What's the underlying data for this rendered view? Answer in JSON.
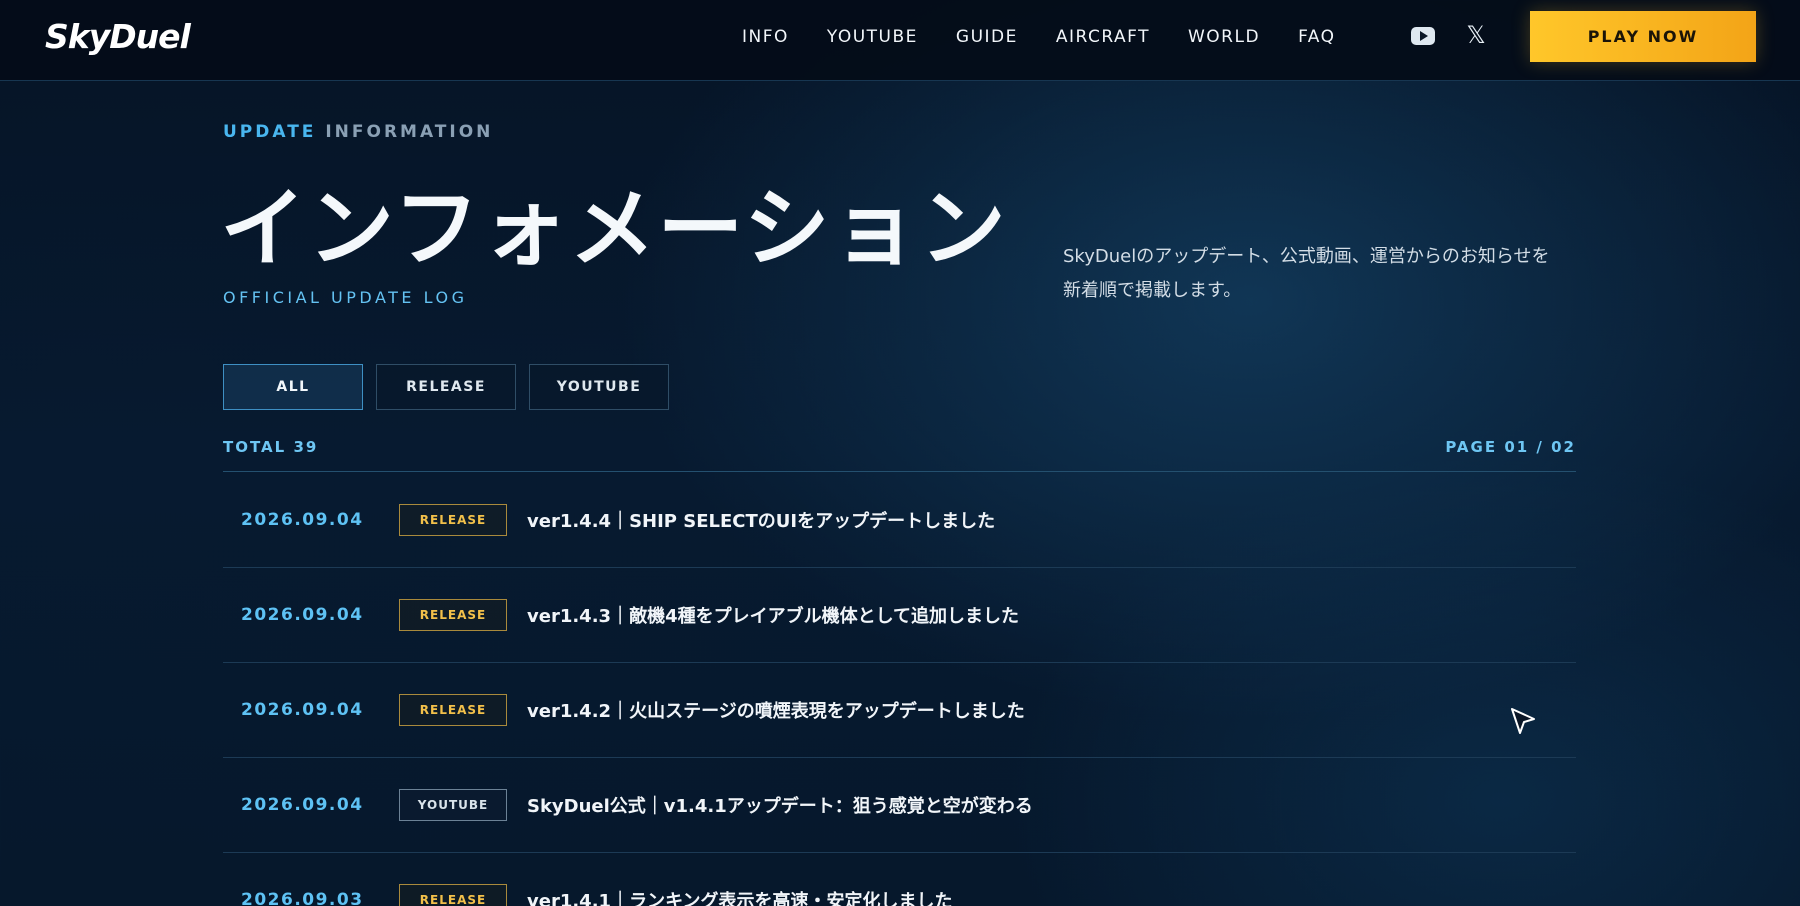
{
  "header": {
    "logo": "SkyDuel",
    "nav": [
      "INFO",
      "YOUTUBE",
      "GUIDE",
      "AIRCRAFT",
      "WORLD",
      "FAQ"
    ],
    "x_icon": "𝕏",
    "play_button": "PLAY NOW"
  },
  "hero": {
    "eyebrow_accent": "UPDATE",
    "eyebrow_rest": "INFORMATION",
    "title": "インフォメーション",
    "subtitle": "OFFICIAL UPDATE LOG",
    "description_line1": "SkyDuelのアップデート、公式動画、運営からのお知らせを",
    "description_line2": "新着順で掲載します。"
  },
  "filters": [
    {
      "label": "ALL",
      "active": true
    },
    {
      "label": "RELEASE",
      "active": false
    },
    {
      "label": "YOUTUBE",
      "active": false
    }
  ],
  "meta": {
    "total": "TOTAL 39",
    "page": "PAGE 01 / 02"
  },
  "entries": [
    {
      "date": "2026.09.04",
      "tag": "RELEASE",
      "title": "ver1.4.4｜SHIP SELECTのUIをアップデートしました"
    },
    {
      "date": "2026.09.04",
      "tag": "RELEASE",
      "title": "ver1.4.3｜敵機4種をプレイアブル機体として追加しました"
    },
    {
      "date": "2026.09.04",
      "tag": "RELEASE",
      "title": "ver1.4.2｜火山ステージの噴煙表現をアップデートしました"
    },
    {
      "date": "2026.09.04",
      "tag": "YOUTUBE",
      "title": "SkyDuel公式｜v1.4.1アップデート：狙う感覚と空が変わる"
    },
    {
      "date": "2026.09.03",
      "tag": "RELEASE",
      "title": "ver1.4.1｜ランキング表示を高速・安定化しました"
    }
  ],
  "colors": {
    "accent": "#49b6ef",
    "cta": "#ffc72a",
    "release_tag": "#f2c04a"
  },
  "icons": [
    "youtube-icon",
    "x-icon",
    "cursor-icon"
  ]
}
